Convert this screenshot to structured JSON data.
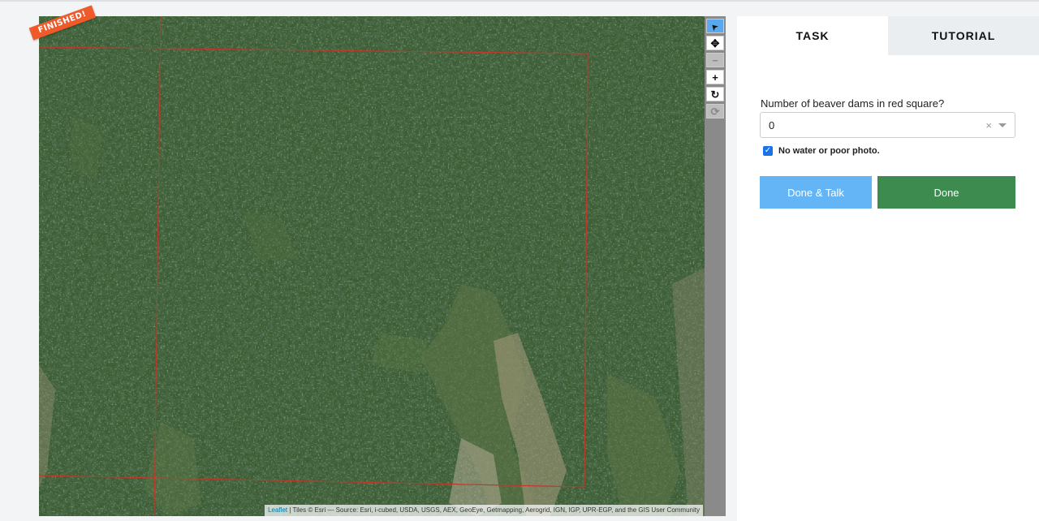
{
  "map": {
    "status_ribbon": "FINISHED!",
    "attribution_link": "Leaflet",
    "attribution_text": " | Tiles © Esri — Source: Esri, i-cubed, USDA, USGS, AEX, GeoEye, Getmapping, Aerogrid, IGN, IGP, UPR-EGP, and the GIS User Community",
    "region_outline_color": "#c0392b"
  },
  "toolbar": {
    "tools": [
      {
        "name": "select-pointer",
        "icon": "arrow-pointer-icon",
        "glyph": "➤",
        "state": "active"
      },
      {
        "name": "pan",
        "icon": "move-arrows-icon",
        "glyph": "✥",
        "state": "normal"
      },
      {
        "name": "zoom-out",
        "icon": "minus-icon",
        "glyph": "−",
        "state": "disabled"
      },
      {
        "name": "zoom-in",
        "icon": "plus-icon",
        "glyph": "+",
        "state": "normal"
      },
      {
        "name": "rotate",
        "icon": "rotate-icon",
        "glyph": "↻",
        "state": "normal"
      },
      {
        "name": "reset",
        "icon": "refresh-icon",
        "glyph": "⟳",
        "state": "disabled"
      }
    ]
  },
  "panel": {
    "tabs": [
      {
        "label": "TASK",
        "active": true
      },
      {
        "label": "TUTORIAL",
        "active": false
      }
    ],
    "question": "Number of beaver dams in red square?",
    "answer_value": "0",
    "clear_glyph": "×",
    "checkbox_label": "No water or poor photo.",
    "checkbox_checked": true,
    "done_talk_label": "Done & Talk",
    "done_label": "Done"
  },
  "colors": {
    "accent_blue": "#64b5f6",
    "done_green": "#3d8b4f",
    "ribbon_orange": "#ef5a2a"
  }
}
